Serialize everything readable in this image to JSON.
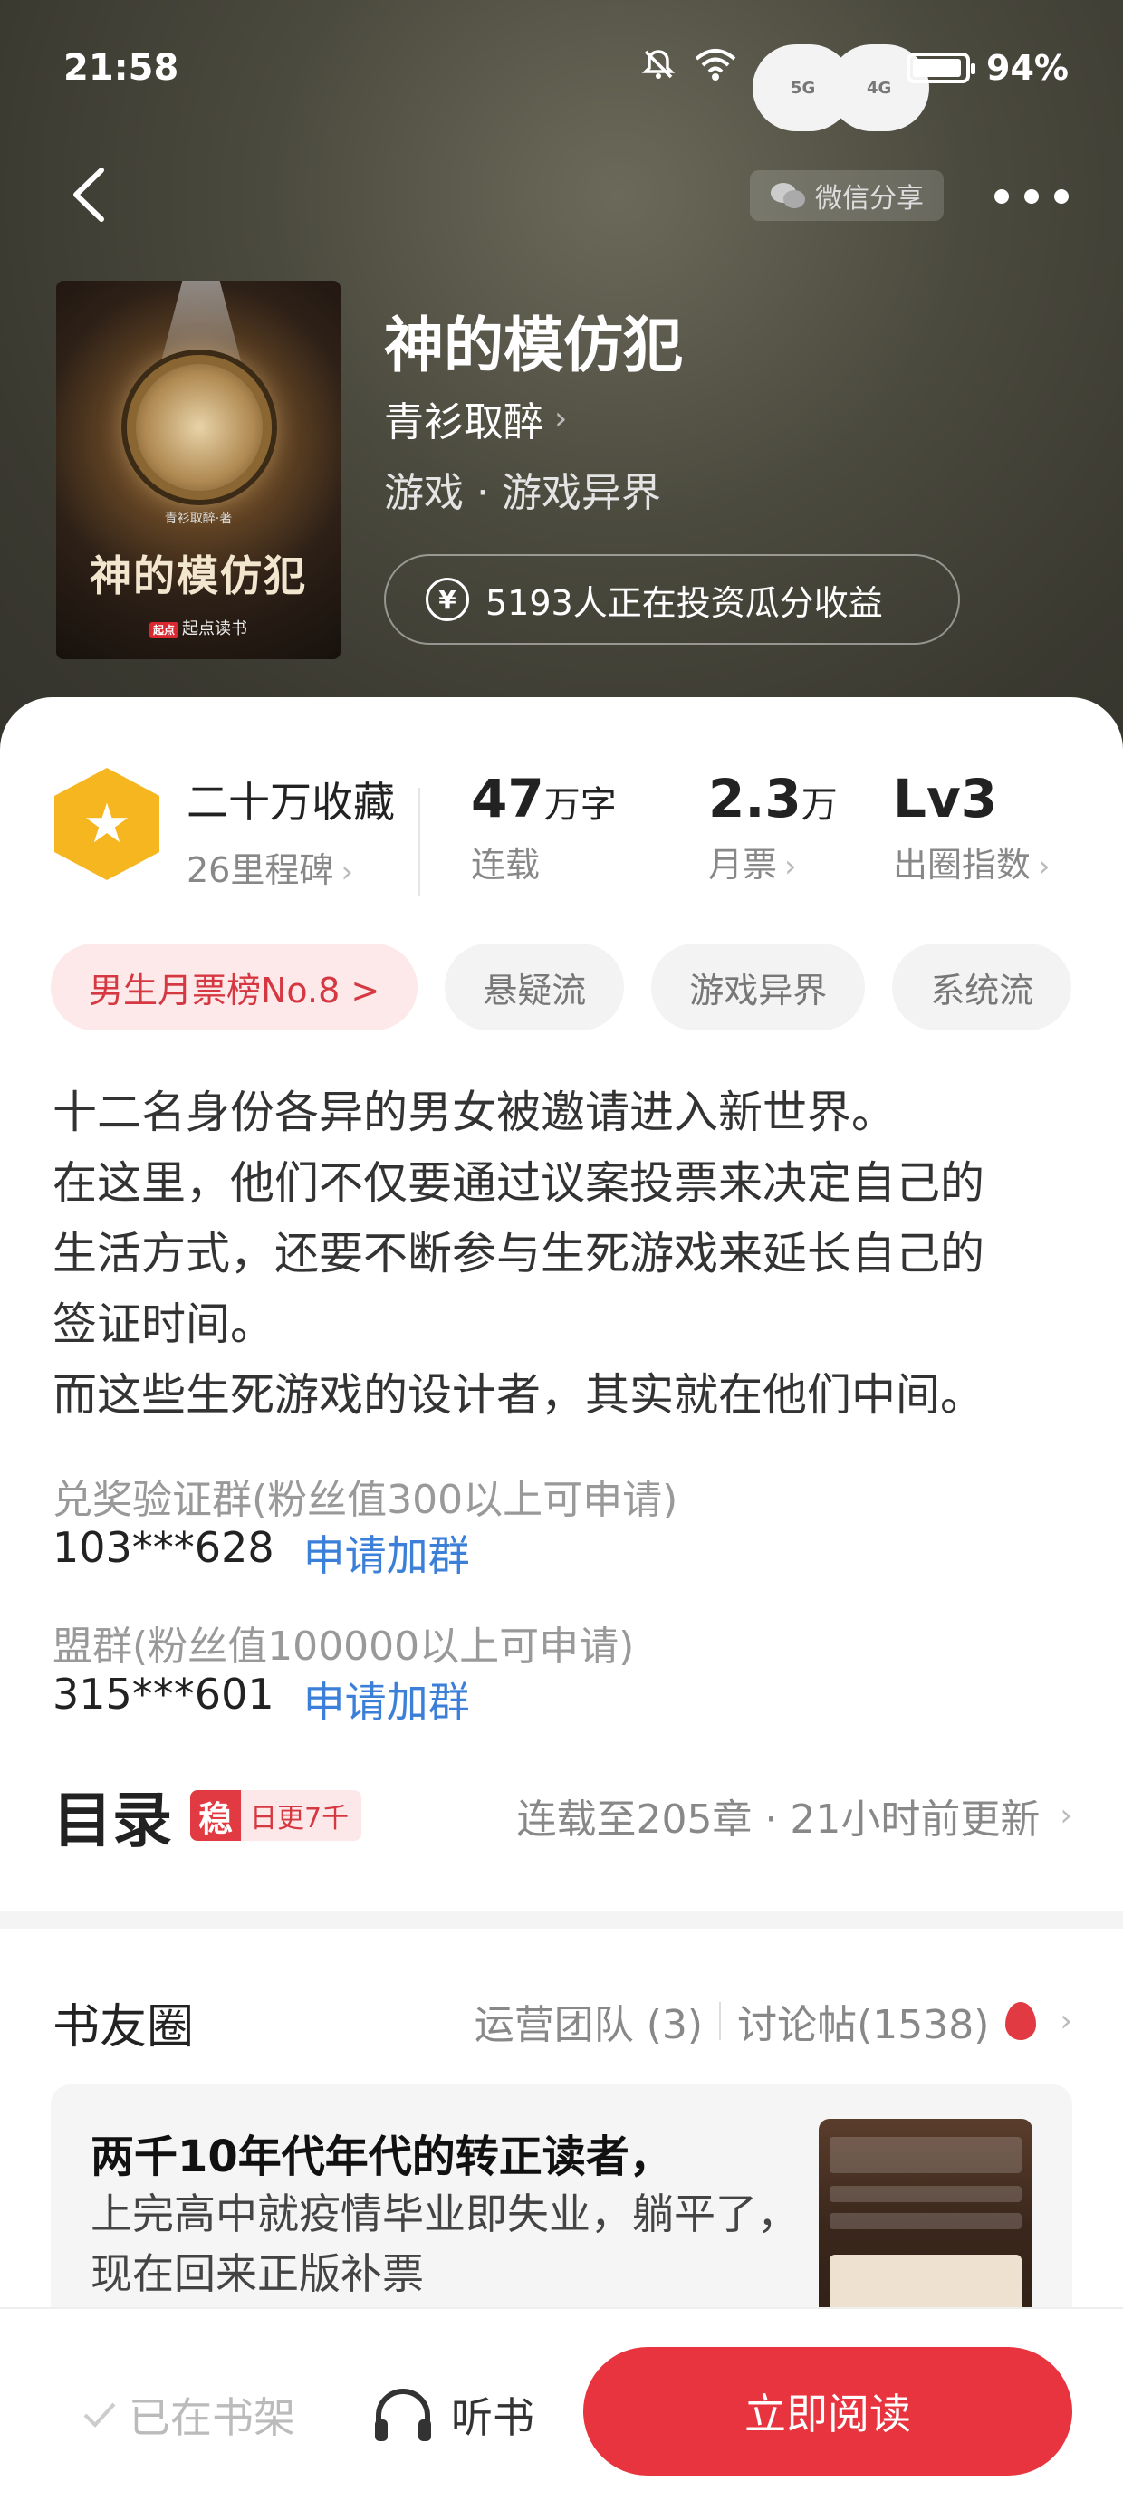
{
  "status_bar": {
    "time": "21:58",
    "battery": "94%",
    "net1": "5G",
    "net2": "4G"
  },
  "nav": {
    "share_label": "微信分享"
  },
  "book": {
    "cover_title": "神的模仿犯",
    "cover_author": "青衫取醉·著",
    "cover_publisher": "起点读书",
    "title": "神的模仿犯",
    "author": "青衫取醉",
    "category": "游戏 · 游戏异界",
    "invest_text": "5193人正在投资瓜分收益"
  },
  "stats": {
    "collect_value": "二十万收藏",
    "collect_label": "26里程碑",
    "words_value": "47",
    "words_unit": "万字",
    "words_label": "连载",
    "tickets_value": "2.3",
    "tickets_unit": "万",
    "tickets_label": "月票",
    "level_value": "Lv3",
    "level_label": "出圈指数"
  },
  "tags": [
    "男生月票榜No.8 >",
    "悬疑流",
    "游戏异界",
    "系统流"
  ],
  "description": [
    "十二名身份各异的男女被邀请进入新世界。",
    "在这里，他们不仅要通过议案投票来决定自己的",
    "生活方式，还要不断参与生死游戏来延长自己的",
    "签证时间。",
    "而这些生死游戏的设计者，其实就在他们中间。"
  ],
  "groups": [
    {
      "title": "兑奖验证群(粉丝值300以上可申请)",
      "number": "103***628",
      "link": "申请加群"
    },
    {
      "title": "盟群(粉丝值100000以上可申请)",
      "number": "315***601",
      "link": "申请加群"
    }
  ],
  "toc": {
    "heading": "目录",
    "badge_icon": "稳",
    "badge_text": "日更7千",
    "info": "连载至205章 · 21小时前更新"
  },
  "friends": {
    "heading": "书友圈",
    "team": "运营团队 (3)",
    "posts_count": "讨论帖(1538)",
    "post_title": "两千10年代年代的转正读者，",
    "post_body": "上完高中就疫情毕业即失业，躺平了，现在回来正版补票"
  },
  "bottom": {
    "shelf": "已在书架",
    "listen": "听书",
    "read": "立即阅读"
  }
}
